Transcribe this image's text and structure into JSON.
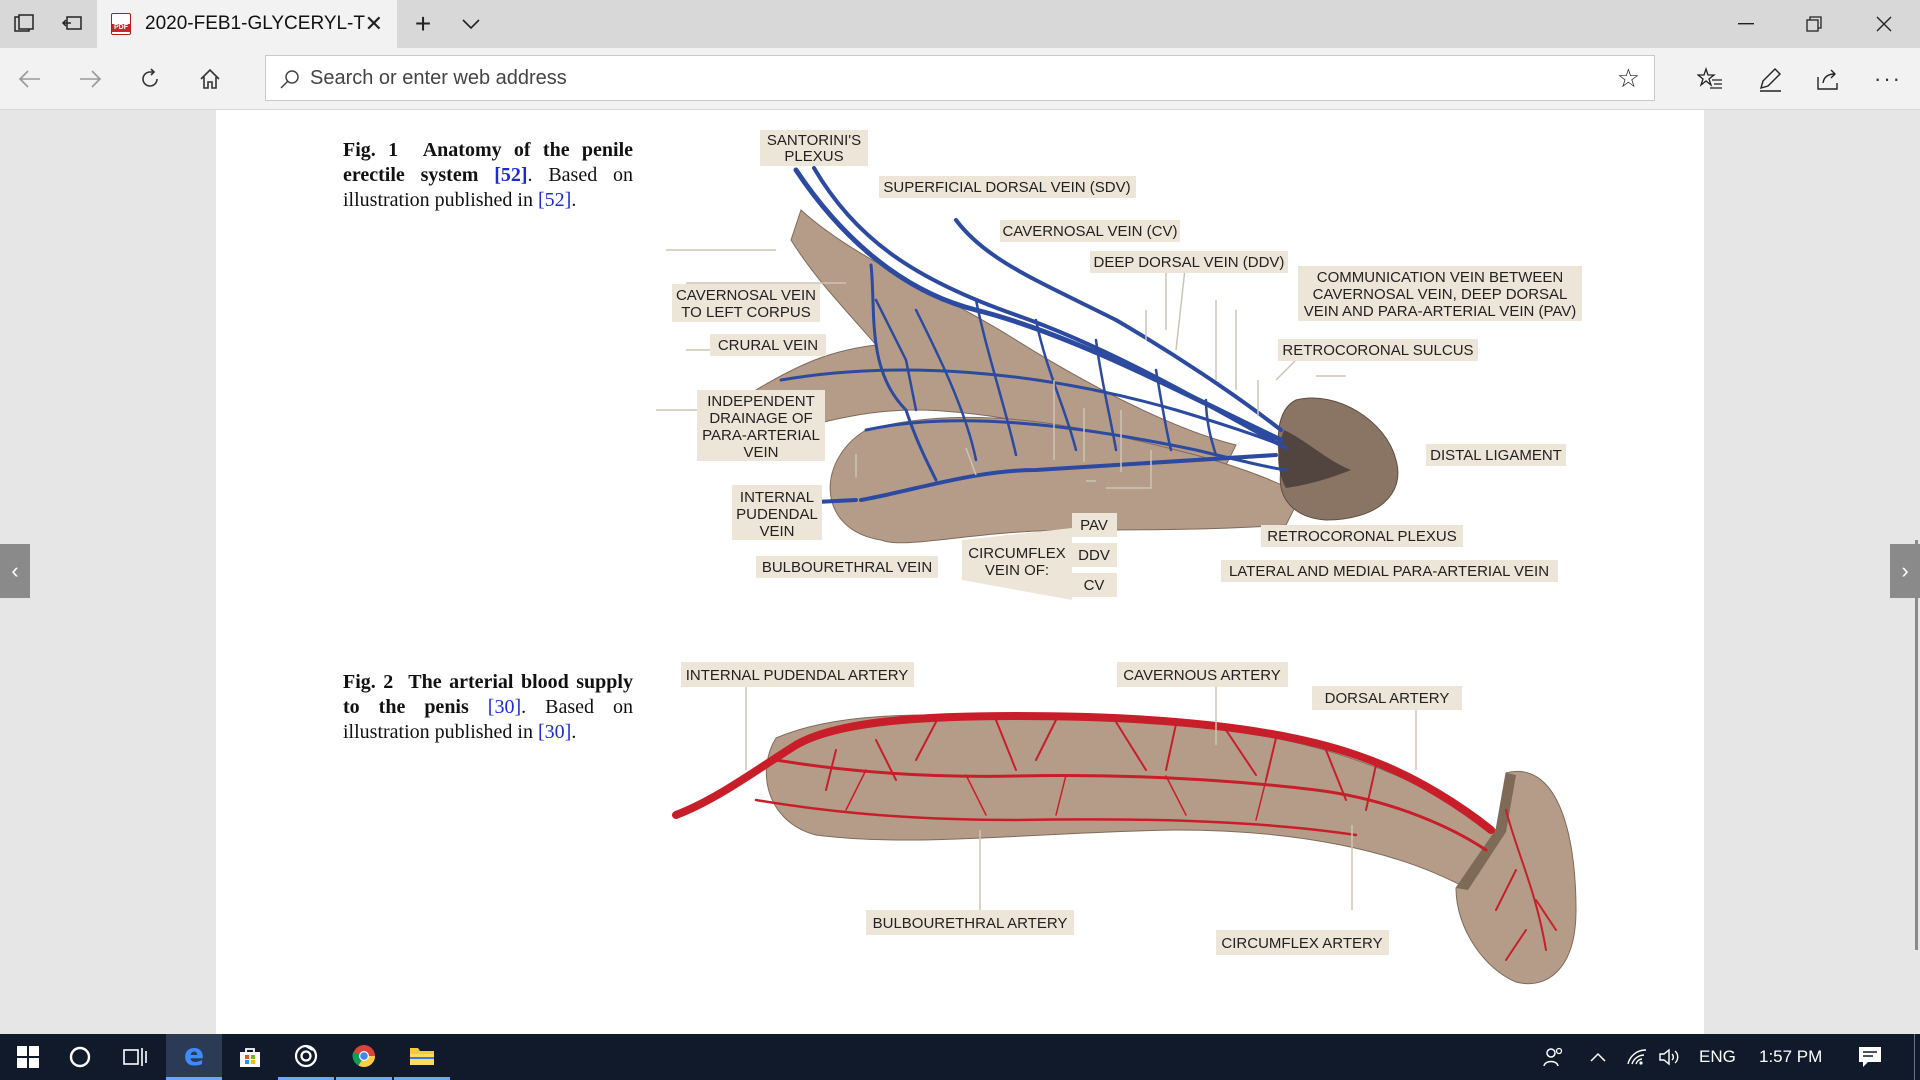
{
  "browser": {
    "tab_title": "2020-FEB1-GLYCERYL-T",
    "address_placeholder": "Search or enter web address"
  },
  "figure1": {
    "caption_label": "Fig. 1",
    "caption_title": "Anatomy of the penile erectile system",
    "caption_ref": "[52]",
    "caption_rest": ". Based on illustration published in",
    "caption_ref2": "[52]",
    "caption_end": ".",
    "labels": {
      "santorini_1": "SANTORINI'S",
      "santorini_2": "PLEXUS",
      "sdv": "SUPERFICIAL DORSAL VEIN (SDV)",
      "cv": "CAVERNOSAL VEIN (CV)",
      "ddv": "DEEP DORSAL VEIN (DDV)",
      "comm_1": "COMMUNICATION VEIN BETWEEN",
      "comm_2": "CAVERNOSAL VEIN, DEEP DORSAL",
      "comm_3": "VEIN AND PARA-ARTERIAL VEIN (PAV)",
      "cav_left_1": "CAVERNOSAL VEIN",
      "cav_left_2": "TO LEFT CORPUS",
      "crural": "CRURAL VEIN",
      "retrocoronal_sulcus": "RETROCORONAL SULCUS",
      "indep_1": "INDEPENDENT",
      "indep_2": "DRAINAGE OF",
      "indep_3": "PARA-ARTERIAL",
      "indep_4": "VEIN",
      "distal_ligament": "DISTAL LIGAMENT",
      "internal_pudendal_1": "INTERNAL",
      "internal_pudendal_2": "PUDENDAL",
      "internal_pudendal_3": "VEIN",
      "pav": "PAV",
      "retrocoronal_plexus": "RETROCORONAL PLEXUS",
      "circumflex_1": "CIRCUMFLEX",
      "circumflex_2": "VEIN OF:",
      "ddv_short": "DDV",
      "bulbourethral_vein": "BULBOURETHRAL VEIN",
      "lateral_medial": "LATERAL AND MEDIAL PARA-ARTERIAL VEIN",
      "cv_short": "CV"
    }
  },
  "figure2": {
    "caption_label": "Fig. 2",
    "caption_title": "The arterial blood supply to the penis",
    "caption_ref": "[30]",
    "caption_rest": ". Based on illustration published in",
    "caption_ref2": "[30]",
    "caption_end": ".",
    "labels": {
      "internal_pudendal_artery": "INTERNAL PUDENDAL ARTERY",
      "cavernous_artery": "CAVERNOUS ARTERY",
      "dorsal_artery": "DORSAL ARTERY",
      "bulbourethral_artery": "BULBOURETHRAL ARTERY",
      "circumflex_artery": "CIRCUMFLEX ARTERY"
    }
  },
  "tray": {
    "language": "ENG",
    "time": "1:57 PM"
  },
  "colors": {
    "vein": "#2c4aa0",
    "artery": "#c81e2a",
    "tissue": "#b59c89",
    "label_bg": "#ede5d8"
  }
}
